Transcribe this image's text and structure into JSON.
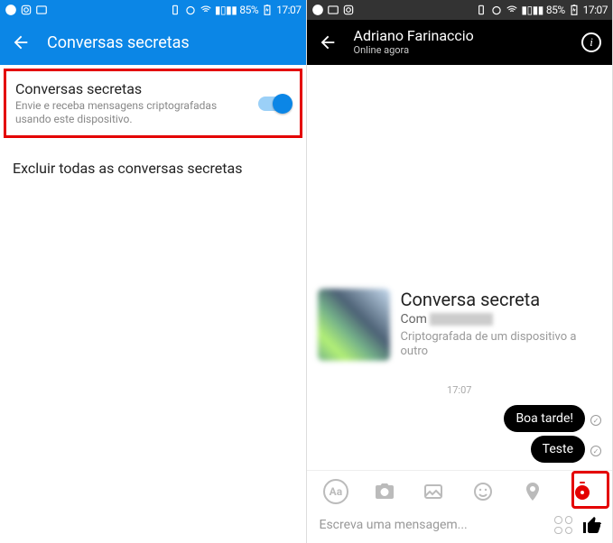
{
  "status_bar": {
    "battery_pct": "85%",
    "time": "17:07"
  },
  "left": {
    "app_bar_title": "Conversas secretas",
    "toggle_title": "Conversas secretas",
    "toggle_desc": "Envie e receba mensagens criptografadas usando este dispositivo.",
    "delete_all": "Excluir todas as conversas secretas"
  },
  "right": {
    "contact_name": "Adriano Farinaccio",
    "presence": "Online agora",
    "intro_heading": "Conversa secreta",
    "intro_with": "Com",
    "intro_desc": "Criptografada de um dispositivo a outro",
    "timestamp": "17:07",
    "messages": [
      "Boa tarde!",
      "Teste"
    ],
    "compose_placeholder": "Escreva uma mensagem..."
  }
}
